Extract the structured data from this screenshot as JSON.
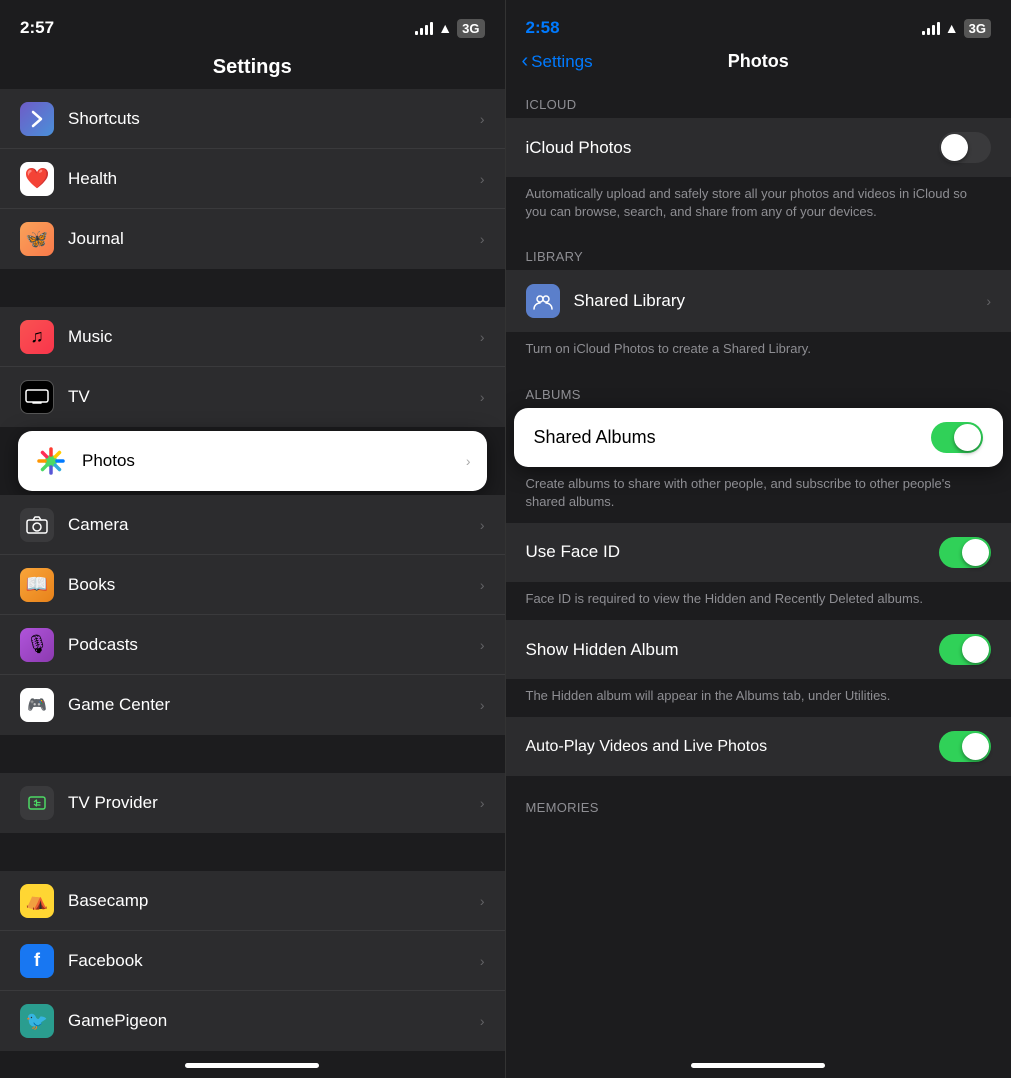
{
  "left": {
    "statusBar": {
      "time": "2:57",
      "battery": "3G"
    },
    "header": "Settings",
    "items": [
      {
        "id": "shortcuts",
        "label": "Shortcuts",
        "iconBg": "icon-shortcuts",
        "iconChar": "🔷"
      },
      {
        "id": "health",
        "label": "Health",
        "iconBg": "icon-health",
        "iconChar": "❤️"
      },
      {
        "id": "journal",
        "label": "Journal",
        "iconBg": "icon-journal",
        "iconChar": "📓"
      },
      {
        "id": "music",
        "label": "Music",
        "iconBg": "icon-music",
        "iconChar": "🎵"
      },
      {
        "id": "tv",
        "label": "TV",
        "iconBg": "icon-tv",
        "iconChar": ""
      },
      {
        "id": "photos",
        "label": "Photos",
        "iconBg": "icon-photos",
        "iconChar": "🌸",
        "highlighted": true
      },
      {
        "id": "camera",
        "label": "Camera",
        "iconBg": "icon-camera",
        "iconChar": "📷"
      },
      {
        "id": "books",
        "label": "Books",
        "iconBg": "icon-books",
        "iconChar": "📖"
      },
      {
        "id": "podcasts",
        "label": "Podcasts",
        "iconBg": "icon-podcasts",
        "iconChar": "🎙"
      },
      {
        "id": "gamecenter",
        "label": "Game Center",
        "iconBg": "icon-gamecenter",
        "iconChar": "🎮"
      },
      {
        "id": "tvprovider",
        "label": "TV Provider",
        "iconBg": "icon-tvprovider",
        "iconChar": "📺"
      },
      {
        "id": "basecamp",
        "label": "Basecamp",
        "iconBg": "icon-basecamp",
        "iconChar": "⛺"
      },
      {
        "id": "facebook",
        "label": "Facebook",
        "iconBg": "icon-facebook",
        "iconChar": "f"
      },
      {
        "id": "gamepigeon",
        "label": "GamePigeon",
        "iconBg": "icon-gamepigeon",
        "iconChar": "🐦"
      }
    ]
  },
  "right": {
    "statusBar": {
      "time": "2:58",
      "battery": "3G"
    },
    "backLabel": "Settings",
    "pageTitle": "Photos",
    "sections": [
      {
        "id": "icloud",
        "label": "ICLOUD",
        "rows": [
          {
            "id": "icloud-photos",
            "label": "iCloud Photos",
            "type": "toggle",
            "toggleOn": false
          }
        ],
        "description": "Automatically upload and safely store all your photos and videos in iCloud so you can browse, search, and share from any of your devices."
      },
      {
        "id": "library",
        "label": "LIBRARY",
        "rows": [
          {
            "id": "shared-library",
            "label": "Shared Library",
            "type": "chevron",
            "hasIcon": true
          }
        ],
        "description": "Turn on iCloud Photos to create a Shared Library."
      },
      {
        "id": "albums",
        "label": "ALBUMS",
        "rows": [
          {
            "id": "shared-albums",
            "label": "Shared Albums",
            "type": "toggle",
            "toggleOn": true,
            "highlighted": true
          }
        ],
        "description": "Create albums to share with other people, and subscribe to other people's shared albums."
      },
      {
        "id": "faceid",
        "label": "",
        "rows": [
          {
            "id": "use-face-id",
            "label": "Use Face ID",
            "type": "toggle",
            "toggleOn": true
          }
        ],
        "description": "Face ID is required to view the Hidden and Recently Deleted albums."
      },
      {
        "id": "hidden",
        "label": "",
        "rows": [
          {
            "id": "show-hidden-album",
            "label": "Show Hidden Album",
            "type": "toggle",
            "toggleOn": true
          }
        ],
        "description": "The Hidden album will appear in the Albums tab, under Utilities."
      },
      {
        "id": "autoplay",
        "label": "",
        "rows": [
          {
            "id": "autoplay-videos",
            "label": "Auto-Play Videos and Live Photos",
            "type": "toggle",
            "toggleOn": true
          }
        ],
        "description": ""
      },
      {
        "id": "memories",
        "label": "MEMORIES",
        "rows": []
      }
    ]
  }
}
